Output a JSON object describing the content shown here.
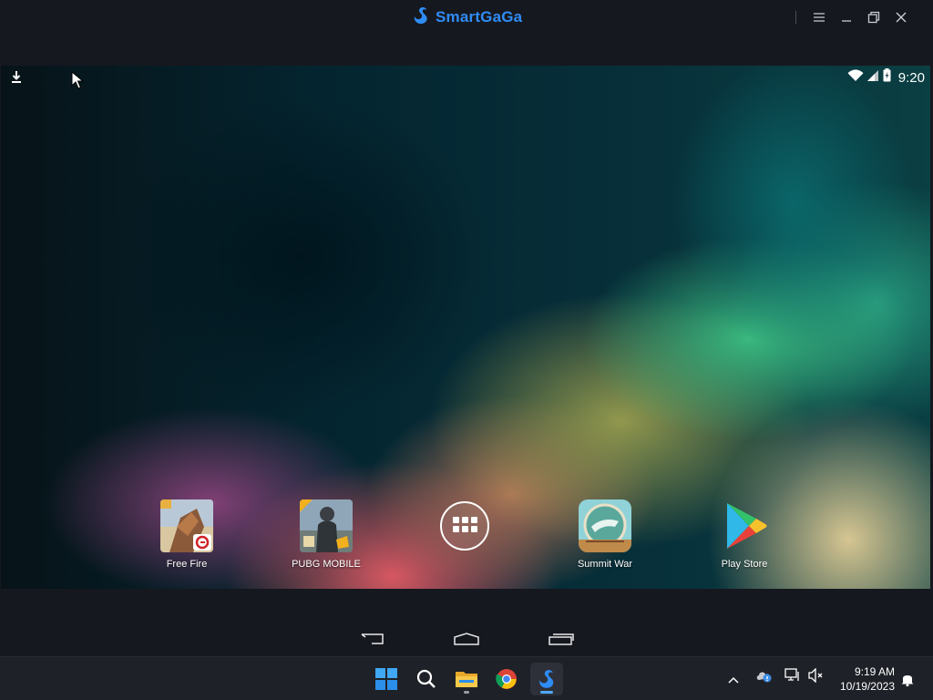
{
  "window": {
    "app_name": "SmartGaGa",
    "controls": [
      "menu",
      "minimize",
      "restore",
      "close"
    ]
  },
  "android": {
    "status_bar": {
      "time": "9:20",
      "icons": [
        "download-icon",
        "wifi-icon",
        "signal-icon",
        "battery-icon"
      ]
    },
    "apps": [
      {
        "label": "Free Fire"
      },
      {
        "label": "PUBG MOBILE"
      },
      {
        "label": "Summit War"
      },
      {
        "label": "Play Store"
      }
    ],
    "nav_buttons": [
      "back",
      "home",
      "recents"
    ]
  },
  "taskbar": {
    "pinned": [
      "start",
      "search",
      "file-explorer",
      "chrome",
      "smartgaga"
    ],
    "time": "9:19 AM",
    "date": "10/19/2023",
    "colors": {
      "accent": "#2f8cf6",
      "indicator": "#50a8f5"
    }
  }
}
